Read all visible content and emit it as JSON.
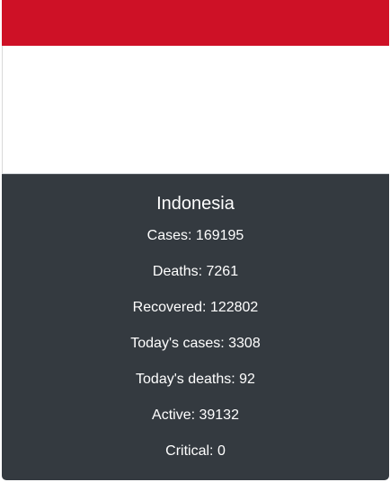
{
  "flag": {
    "name": "indonesia-flag",
    "top_color": "#ce1126",
    "bottom_color": "#ffffff"
  },
  "card": {
    "background": "#343a40",
    "country": "Indonesia",
    "stats": [
      {
        "label": "Cases",
        "value": "169195",
        "text": "Cases: 169195"
      },
      {
        "label": "Deaths",
        "value": "7261",
        "text": "Deaths: 7261"
      },
      {
        "label": "Recovered",
        "value": "122802",
        "text": "Recovered: 122802"
      },
      {
        "label": "Today's cases",
        "value": "3308",
        "text": "Today's cases: 3308"
      },
      {
        "label": "Today's deaths",
        "value": "92",
        "text": "Today's deaths: 92"
      },
      {
        "label": "Active",
        "value": "39132",
        "text": "Active: 39132"
      },
      {
        "label": "Critical",
        "value": "0",
        "text": "Critical: 0"
      }
    ]
  }
}
